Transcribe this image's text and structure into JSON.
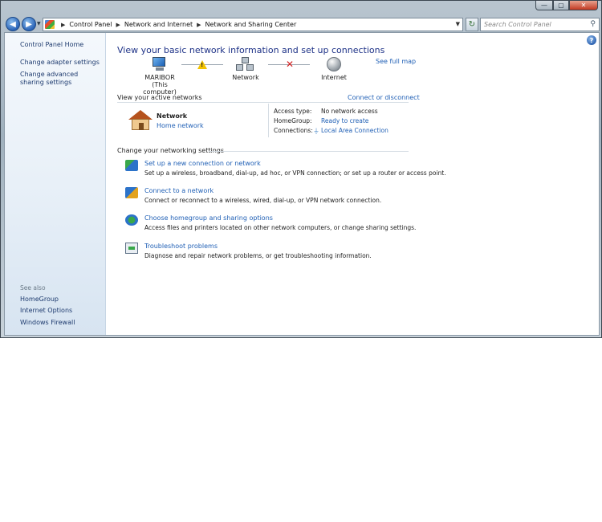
{
  "window": {
    "caption": {
      "minimize": "—",
      "maximize": "▢",
      "close": "✕"
    }
  },
  "navbar": {
    "back": "◀",
    "forward": "▶",
    "breadcrumb": [
      "Control Panel",
      "Network and Internet",
      "Network and Sharing Center"
    ],
    "search_placeholder": "Search Control Panel",
    "refresh": "↻",
    "search_icon": "⚲"
  },
  "sidebar": {
    "home": "Control Panel Home",
    "links": [
      "Change adapter settings",
      "Change advanced sharing settings"
    ],
    "see_also_label": "See also",
    "see_also": [
      "HomeGroup",
      "Internet Options",
      "Windows Firewall"
    ]
  },
  "main": {
    "title": "View your basic network information and set up connections",
    "see_full_map": "See full map",
    "map": {
      "computer_name": "MARIBOR",
      "computer_sub": "(This computer)",
      "network": "Network",
      "internet": "Internet"
    },
    "active_networks_label": "View your active networks",
    "connect_or_disconnect": "Connect or disconnect",
    "active_network": {
      "name": "Network",
      "type": "Home network",
      "access_type_label": "Access type:",
      "access_type_value": "No network access",
      "homegroup_label": "HomeGroup:",
      "homegroup_value": "Ready to create",
      "connections_label": "Connections:",
      "connections_value": "Local Area Connection"
    },
    "change_settings_label": "Change your networking settings",
    "tasks": [
      {
        "title": "Set up a new connection or network",
        "desc": "Set up a wireless, broadband, dial-up, ad hoc, or VPN connection; or set up a router or access point."
      },
      {
        "title": "Connect to a network",
        "desc": "Connect or reconnect to a wireless, wired, dial-up, or VPN network connection."
      },
      {
        "title": "Choose homegroup and sharing options",
        "desc": "Access files and printers located on other network computers, or change sharing settings."
      },
      {
        "title": "Troubleshoot problems",
        "desc": "Diagnose and repair network problems, or get troubleshooting information."
      }
    ]
  },
  "colors": {
    "link": "#1f5fb5",
    "title": "#1e3287",
    "warning": "#f2c200",
    "error": "#d11f1f"
  }
}
